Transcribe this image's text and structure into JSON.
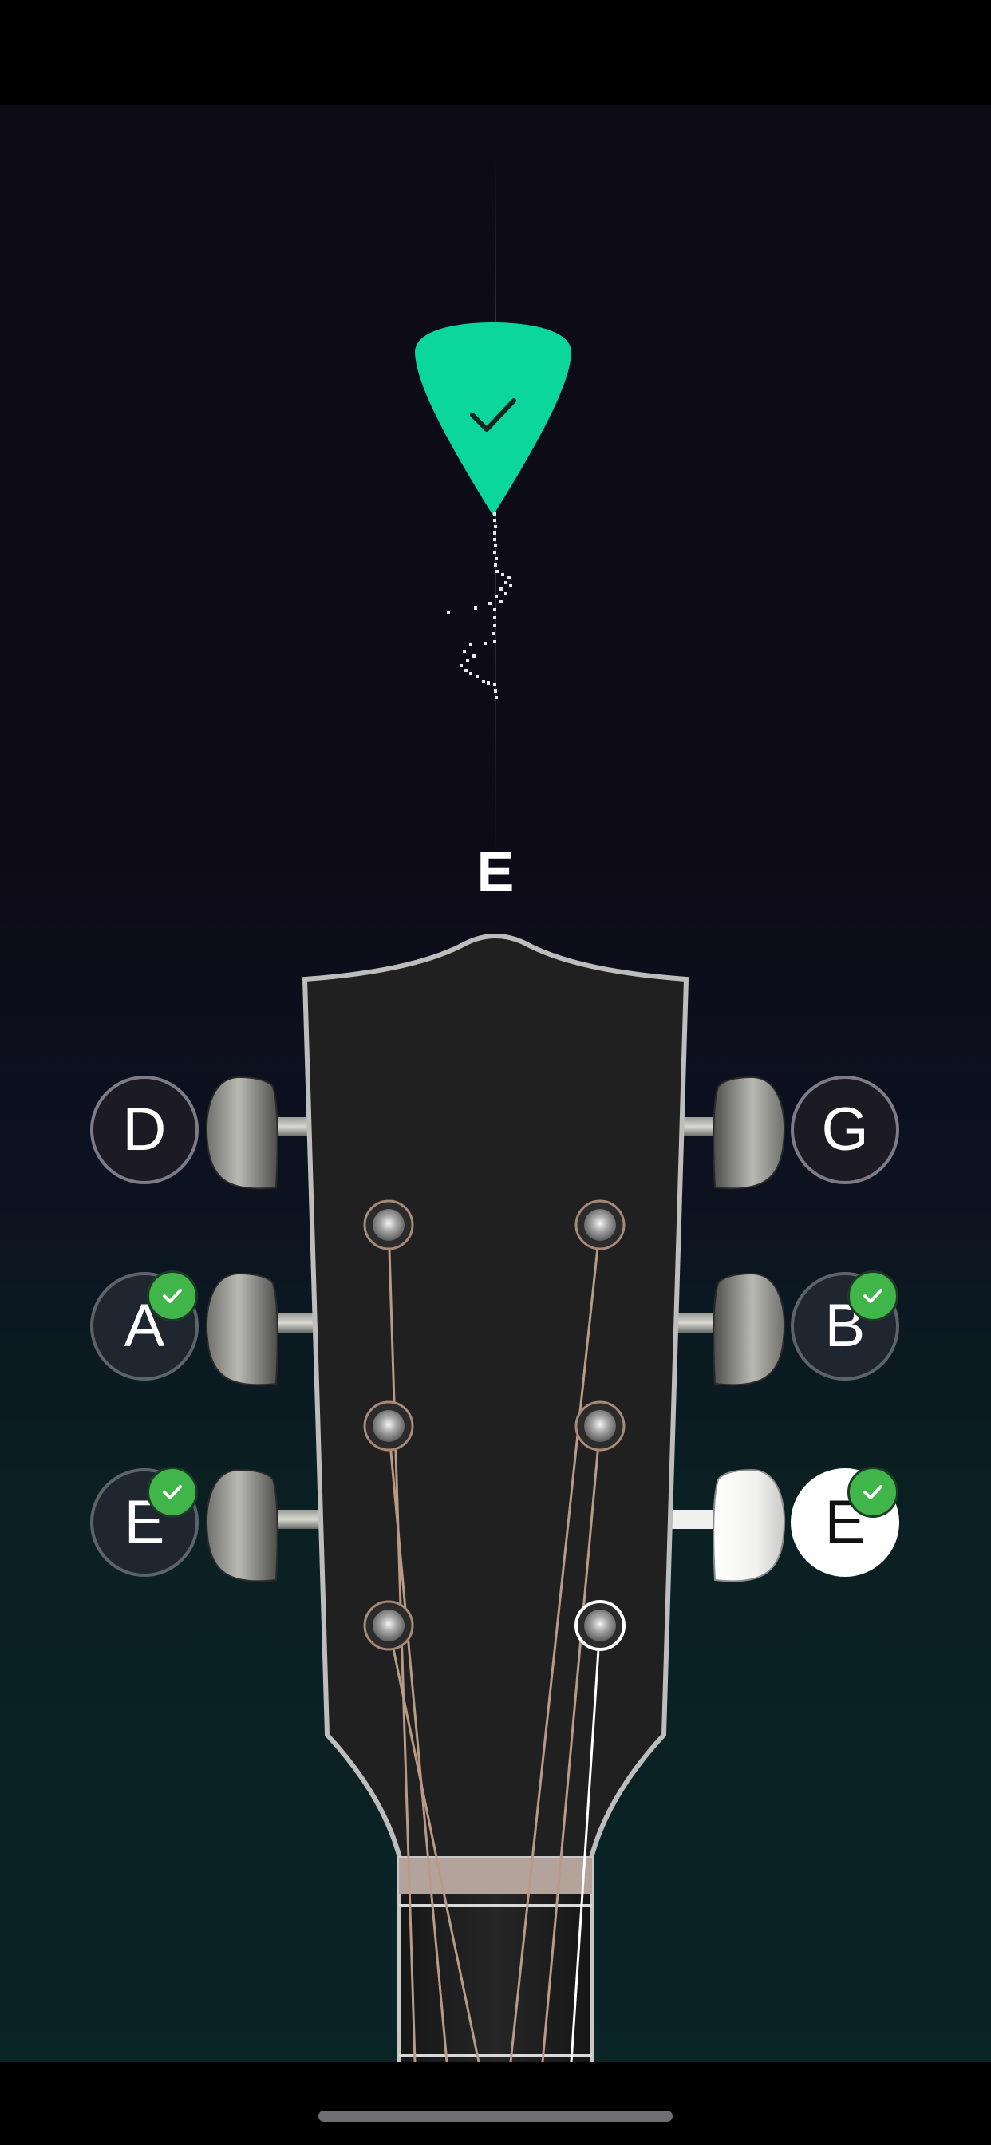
{
  "colors": {
    "accent": "#0bd79c",
    "check_badge": "#3fb54a",
    "background_top": "#0e0b18",
    "background_bottom": "#0a2526",
    "headstock": "#202020"
  },
  "tuner": {
    "status_icon": "checkmark-icon",
    "target_note": "E"
  },
  "strings": [
    {
      "note": "D",
      "tuned": false,
      "selected": false
    },
    {
      "note": "A",
      "tuned": true,
      "selected": false
    },
    {
      "note": "E",
      "tuned": true,
      "selected": false
    },
    {
      "note": "G",
      "tuned": false,
      "selected": false
    },
    {
      "note": "B",
      "tuned": true,
      "selected": false
    },
    {
      "note": "E",
      "tuned": true,
      "selected": true
    }
  ]
}
